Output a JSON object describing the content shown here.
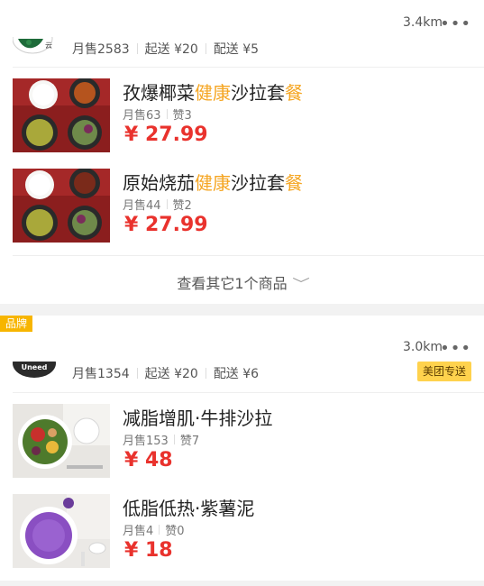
{
  "stores": [
    {
      "distance": "3.4km",
      "more": "•••",
      "stats": {
        "monthly_sales": "月售2583",
        "min_order": "起送 ¥20",
        "delivery_fee": "配送 ¥5"
      },
      "products": [
        {
          "name_a": "孜爆椰菜",
          "name_hl1": "健康",
          "name_b": "沙拉套",
          "name_hl2": "餐",
          "sales": "月售63",
          "likes": "赞3",
          "price": "¥ 27.99"
        },
        {
          "name_a": "原始烧茄",
          "name_hl1": "健康",
          "name_b": "沙拉套",
          "name_hl2": "餐",
          "sales": "月售44",
          "likes": "赞2",
          "price": "¥ 27.99"
        }
      ],
      "see_more": "查看其它1个商品",
      "see_more_chevron": "﹀"
    },
    {
      "brand_badge": "品牌",
      "logo_text": "Uneed",
      "distance": "3.0km",
      "more": "•••",
      "stats": {
        "monthly_sales": "月售1354",
        "min_order": "起送 ¥20",
        "delivery_fee": "配送 ¥6"
      },
      "delivery_badge": "美团专送",
      "products": [
        {
          "name": "减脂增肌·牛排沙拉",
          "sales": "月售153",
          "likes": "赞7",
          "price": "¥ 48"
        },
        {
          "name": "低脂低热·紫薯泥",
          "sales": "月售4",
          "likes": "赞0",
          "price": "¥ 18"
        }
      ]
    }
  ],
  "colors": {
    "price": "#e9322d",
    "highlight": "#f5a623",
    "brand_badge": "#f7b500",
    "delivery_badge": "#ffd24d"
  },
  "icons": [
    "more-dots-icon",
    "chevron-down-icon"
  ]
}
